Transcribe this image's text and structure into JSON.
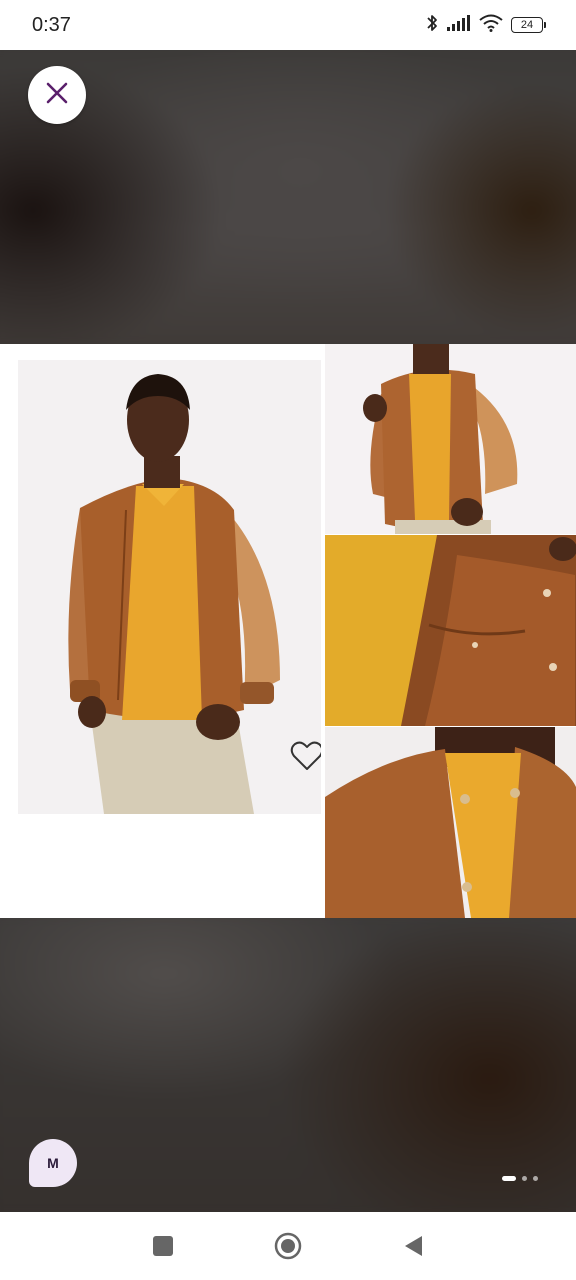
{
  "status_bar": {
    "time": "0:37",
    "battery_level": "24",
    "icons": [
      "bluetooth-icon",
      "signal-icon",
      "wifi-icon",
      "battery-icon"
    ]
  },
  "viewer": {
    "close_icon": "close-icon",
    "accent_color": "#5a1f6b",
    "wishlist_icon": "heart-outline-icon"
  },
  "assistant": {
    "label": "M"
  },
  "pager": {
    "total": 3,
    "current": 1
  },
  "nav_bar": {
    "buttons": [
      "recents-icon",
      "home-icon",
      "back-icon"
    ]
  }
}
